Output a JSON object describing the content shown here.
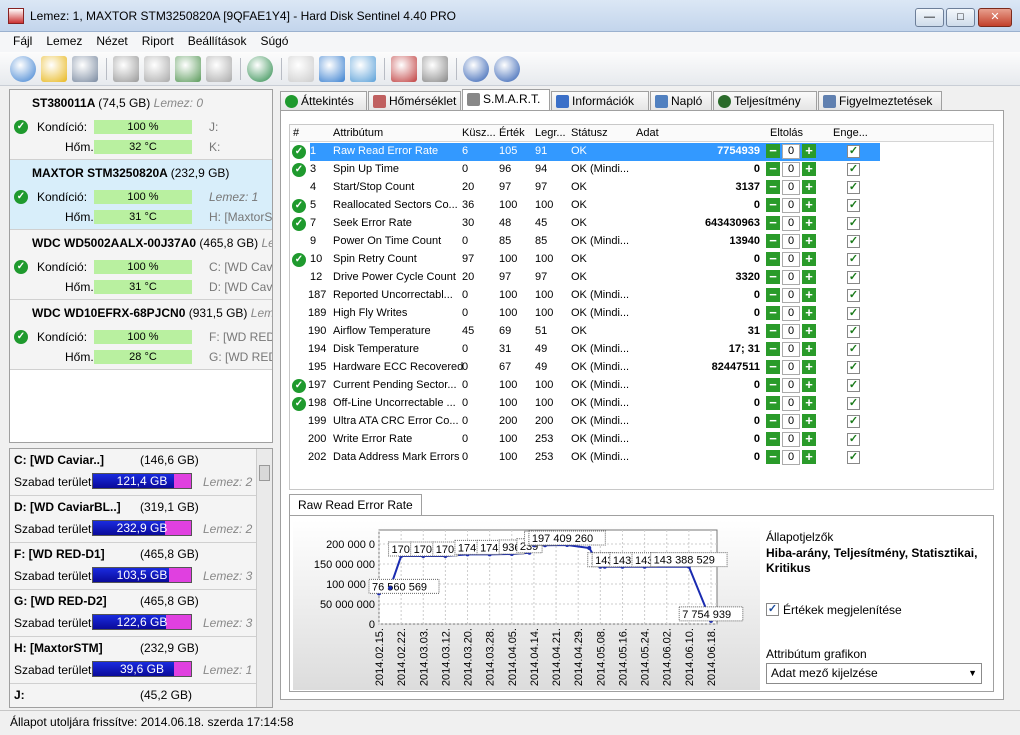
{
  "window": {
    "title": "Lemez: 1, MAXTOR STM3250820A [9QFAE1Y4]  -  Hard Disk Sentinel 4.40 PRO",
    "min": "—",
    "max": "□",
    "close": "✕"
  },
  "menu": [
    "Fájl",
    "Lemez",
    "Nézet",
    "Riport",
    "Beállítások",
    "Súgó"
  ],
  "toolbar": [
    "refresh-icon",
    "warning-icon",
    "disk-icon",
    "sep",
    "wrench-gray-icon",
    "wrench-icon",
    "wrench-check-icon",
    "wrench-off-icon",
    "sep",
    "globe-icon",
    "sep",
    "document-icon",
    "sync-icon",
    "network-icon",
    "sep",
    "chart-icon",
    "speaker-icon",
    "sep",
    "help-icon",
    "info-icon"
  ],
  "disks": [
    {
      "name": "ST380011A",
      "size": "(74,5 GB)",
      "lemez": "Lemez: 0",
      "kond_label": "Kondíció:",
      "kond": "100 %",
      "hom_label": "Hőm.:",
      "hom": "32 °C",
      "p1": "J:",
      "p2": "K:",
      "selected": false
    },
    {
      "name": "MAXTOR STM3250820A",
      "size": "(232,9 GB)",
      "lemez": "",
      "kond_label": "Kondíció:",
      "kond": "100 %",
      "hom_label": "Hőm.:",
      "hom": "31 °C",
      "p1": "Lemez: 1",
      "p2": "H: [MaxtorSTM",
      "selected": true
    },
    {
      "name": "WDC WD5002AALX-00J37A0",
      "size": "(465,8 GB)",
      "lemez": "Le",
      "kond_label": "Kondíció:",
      "kond": "100 %",
      "hom_label": "Hőm.:",
      "hom": "31 °C",
      "p1": "C: [WD Caviar",
      "p2": "D: [WD Cavia",
      "selected": false
    },
    {
      "name": "WDC WD10EFRX-68PJCN0",
      "size": "(931,5 GB)",
      "lemez": "Lemez",
      "kond_label": "Kondíció:",
      "kond": "100 %",
      "hom_label": "Hőm.:",
      "hom": "28 °C",
      "p1": "F: [WD RED-D",
      "p2": "G: [WD RED-D",
      "selected": false
    }
  ],
  "partitions": [
    {
      "name": "C: [WD Caviar..]",
      "size": "(146,6 GB)",
      "free_label": "Szabad terület",
      "free": "121,4 GB",
      "free_frac": 0.83,
      "lemez": "Lemez: 2"
    },
    {
      "name": "D: [WD CaviarBL..]",
      "size": "(319,1 GB)",
      "free_label": "Szabad terület",
      "free": "232,9 GB",
      "free_frac": 0.73,
      "lemez": "Lemez: 2"
    },
    {
      "name": "F: [WD RED-D1]",
      "size": "(465,8 GB)",
      "free_label": "Szabad terület",
      "free": "103,5 GB",
      "free_frac": 0.78,
      "lemez": "Lemez: 3"
    },
    {
      "name": "G: [WD RED-D2]",
      "size": "(465,8 GB)",
      "free_label": "Szabad terület",
      "free": "122,6 GB",
      "free_frac": 0.74,
      "lemez": "Lemez: 3"
    },
    {
      "name": "H: [MaxtorSTM]",
      "size": "(232,9 GB)",
      "free_label": "Szabad terület",
      "free": "39,6 GB",
      "free_frac": 0.83,
      "lemez": "Lemez: 1"
    },
    {
      "name": "J:",
      "size": "(45,2 GB)",
      "free_label": "",
      "free": "",
      "free_frac": 0,
      "lemez": ""
    }
  ],
  "tabs": [
    {
      "label": "Áttekintés",
      "icon": "check-icon",
      "color": "#1f9a2e"
    },
    {
      "label": "Hőmérséklet",
      "icon": "thermometer-icon",
      "color": "#c06060"
    },
    {
      "label": "S.M.A.R.T.",
      "icon": "wrench-icon",
      "color": "#888888"
    },
    {
      "label": "Információk",
      "icon": "info-icon",
      "color": "#3a6fc8"
    },
    {
      "label": "Napló",
      "icon": "log-icon",
      "color": "#5080c0"
    },
    {
      "label": "Teljesítmény",
      "icon": "gauge-icon",
      "color": "#2a6a2a"
    },
    {
      "label": "Figyelmeztetések",
      "icon": "alert-icon",
      "color": "#6080b0"
    }
  ],
  "smart_headers": {
    "num": "#",
    "attr": "Attribútum",
    "kusz": "Küsz...",
    "ertek": "Érték",
    "legr": "Legr...",
    "status": "Státusz",
    "adat": "Adat",
    "eltolas": "Eltolás",
    "enge": "Enge..."
  },
  "smart": [
    {
      "ok": true,
      "num": "1",
      "attr": "Raw Read Error Rate",
      "kusz": "6",
      "ertek": "105",
      "legr": "91",
      "status": "OK",
      "adat": "7754939",
      "offset": "0"
    },
    {
      "ok": true,
      "num": "3",
      "attr": "Spin Up Time",
      "kusz": "0",
      "ertek": "96",
      "legr": "94",
      "status": "OK (Mindi...",
      "adat": "0",
      "offset": "0"
    },
    {
      "ok": false,
      "num": "4",
      "attr": "Start/Stop Count",
      "kusz": "20",
      "ertek": "97",
      "legr": "97",
      "status": "OK",
      "adat": "3137",
      "offset": "0"
    },
    {
      "ok": true,
      "num": "5",
      "attr": "Reallocated Sectors Co...",
      "kusz": "36",
      "ertek": "100",
      "legr": "100",
      "status": "OK",
      "adat": "0",
      "offset": "0"
    },
    {
      "ok": true,
      "num": "7",
      "attr": "Seek Error Rate",
      "kusz": "30",
      "ertek": "48",
      "legr": "45",
      "status": "OK",
      "adat": "643430963",
      "offset": "0"
    },
    {
      "ok": false,
      "num": "9",
      "attr": "Power On Time Count",
      "kusz": "0",
      "ertek": "85",
      "legr": "85",
      "status": "OK (Mindi...",
      "adat": "13940",
      "offset": "0"
    },
    {
      "ok": true,
      "num": "10",
      "attr": "Spin Retry Count",
      "kusz": "97",
      "ertek": "100",
      "legr": "100",
      "status": "OK",
      "adat": "0",
      "offset": "0"
    },
    {
      "ok": false,
      "num": "12",
      "attr": "Drive Power Cycle Count",
      "kusz": "20",
      "ertek": "97",
      "legr": "97",
      "status": "OK",
      "adat": "3320",
      "offset": "0"
    },
    {
      "ok": false,
      "num": "187",
      "attr": "Reported Uncorrectabl...",
      "kusz": "0",
      "ertek": "100",
      "legr": "100",
      "status": "OK (Mindi...",
      "adat": "0",
      "offset": "0"
    },
    {
      "ok": false,
      "num": "189",
      "attr": "High Fly Writes",
      "kusz": "0",
      "ertek": "100",
      "legr": "100",
      "status": "OK (Mindi...",
      "adat": "0",
      "offset": "0"
    },
    {
      "ok": false,
      "num": "190",
      "attr": "Airflow Temperature",
      "kusz": "45",
      "ertek": "69",
      "legr": "51",
      "status": "OK",
      "adat": "31",
      "offset": "0"
    },
    {
      "ok": false,
      "num": "194",
      "attr": "Disk Temperature",
      "kusz": "0",
      "ertek": "31",
      "legr": "49",
      "status": "OK (Mindi...",
      "adat": "17; 31",
      "offset": "0"
    },
    {
      "ok": false,
      "num": "195",
      "attr": "Hardware ECC Recovered",
      "kusz": "0",
      "ertek": "67",
      "legr": "49",
      "status": "OK (Mindi...",
      "adat": "82447511",
      "offset": "0"
    },
    {
      "ok": true,
      "num": "197",
      "attr": "Current Pending Sector...",
      "kusz": "0",
      "ertek": "100",
      "legr": "100",
      "status": "OK (Mindi...",
      "adat": "0",
      "offset": "0"
    },
    {
      "ok": true,
      "num": "198",
      "attr": "Off-Line Uncorrectable ...",
      "kusz": "0",
      "ertek": "100",
      "legr": "100",
      "status": "OK (Mindi...",
      "adat": "0",
      "offset": "0"
    },
    {
      "ok": false,
      "num": "199",
      "attr": "Ultra ATA CRC Error Co...",
      "kusz": "0",
      "ertek": "200",
      "legr": "200",
      "status": "OK (Mindi...",
      "adat": "0",
      "offset": "0"
    },
    {
      "ok": false,
      "num": "200",
      "attr": "Write Error Rate",
      "kusz": "0",
      "ertek": "100",
      "legr": "253",
      "status": "OK (Mindi...",
      "adat": "0",
      "offset": "0"
    },
    {
      "ok": false,
      "num": "202",
      "attr": "Data Address Mark Errors",
      "kusz": "0",
      "ertek": "100",
      "legr": "253",
      "status": "OK (Mindi...",
      "adat": "0",
      "offset": "0"
    }
  ],
  "chart_tab": "Raw Read Error Rate",
  "chart_data": {
    "type": "line",
    "title": "",
    "yticks": [
      "200 000 0",
      "150 000 000",
      "100 000 0",
      "50 000 000",
      "0"
    ],
    "ylim": [
      0,
      200000000
    ],
    "x": [
      "2014.02.15.",
      "2014.02.22.",
      "2014.03.03.",
      "2014.03.12.",
      "2014.03.20.",
      "2014.03.28.",
      "2014.04.05.",
      "2014.04.14.",
      "2014.04.21.",
      "2014.04.29.",
      "2014.05.08.",
      "2014.05.16.",
      "2014.05.24.",
      "2014.06.02.",
      "2014.06.10.",
      "2014.06.18."
    ],
    "points": [
      {
        "x": 0,
        "y": 76560569,
        "label": "76 560 569"
      },
      {
        "x": 0.5,
        "y": 90000000,
        "label": ""
      },
      {
        "x": 1,
        "y": 170000000,
        "label": "170"
      },
      {
        "x": 2,
        "y": 170000000,
        "label": "170"
      },
      {
        "x": 3,
        "y": 170000000,
        "label": "170"
      },
      {
        "x": 4,
        "y": 174000000,
        "label": "174"
      },
      {
        "x": 5,
        "y": 174000000,
        "label": "174"
      },
      {
        "x": 6,
        "y": 175000000,
        "label": "936"
      },
      {
        "x": 6.8,
        "y": 178000000,
        "label": "239"
      },
      {
        "x": 7,
        "y": 197000000,
        "label": "19"
      },
      {
        "x": 7.5,
        "y": 197000000,
        "label": "197"
      },
      {
        "x": 8.5,
        "y": 197409260,
        "label": "197 409 260"
      },
      {
        "x": 9.5,
        "y": 190000000,
        "label": ""
      },
      {
        "x": 10,
        "y": 143000000,
        "label": "133"
      },
      {
        "x": 10.2,
        "y": 143000000,
        "label": "143"
      },
      {
        "x": 11,
        "y": 143000000,
        "label": "143"
      },
      {
        "x": 12,
        "y": 143000000,
        "label": "143"
      },
      {
        "x": 14,
        "y": 143388529,
        "label": "143 388 529"
      },
      {
        "x": 15,
        "y": 7754939,
        "label": "7 754 939"
      }
    ]
  },
  "right": {
    "title": "Állapotjelzők",
    "desc": "Hiba-arány, Teljesítmény, Statisztikai, Kritikus",
    "show_values": "Értékek megjelenítése",
    "graph_label": "Attribútum grafikon",
    "combo": "Adat mező kijelzése"
  },
  "status": "Állapot utoljára frissítve: 2014.06.18. szerda 17:14:58"
}
